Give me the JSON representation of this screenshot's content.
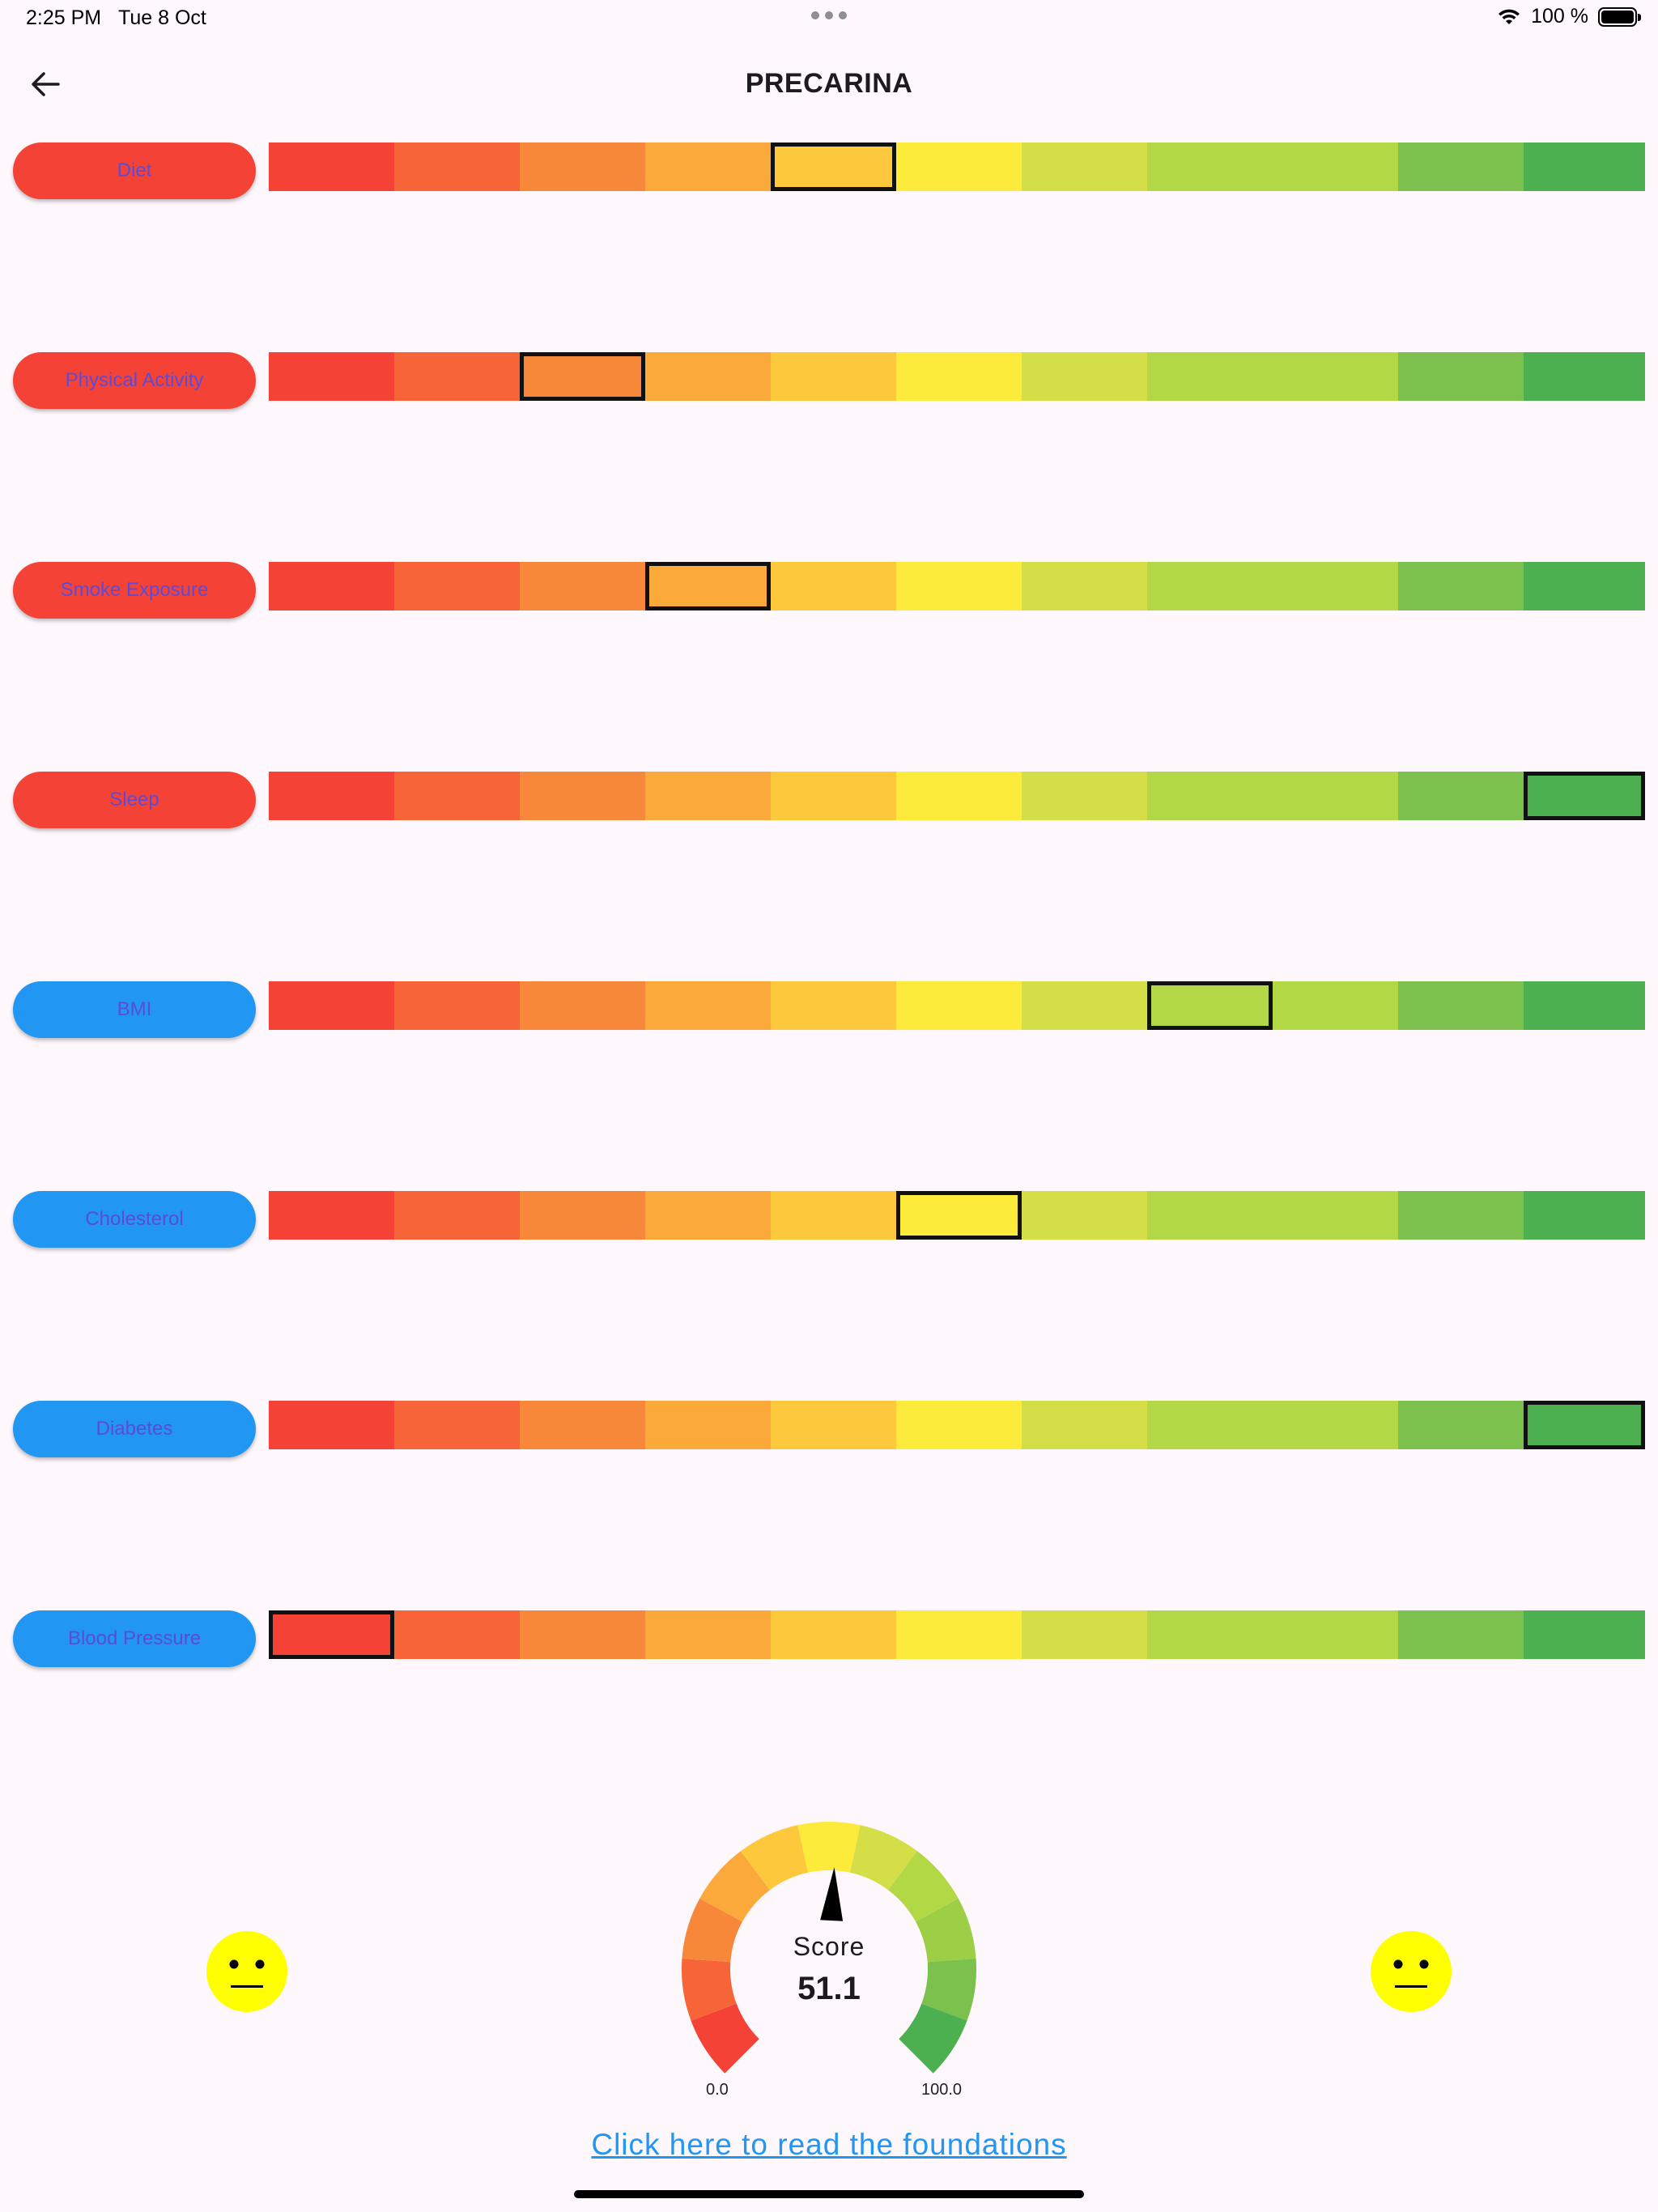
{
  "status_bar": {
    "time": "2:25 PM",
    "date": "Tue 8 Oct",
    "battery": "100 %"
  },
  "header": {
    "title": "PRECARINA",
    "back_icon": "arrow-left-icon"
  },
  "scale_colors": [
    "#f44336",
    "#f76438",
    "#f7883a",
    "#fba93a",
    "#fec83c",
    "#fdeb3b",
    "#d4de46",
    "#b2d845",
    "#b2d845",
    "#7cc04d",
    "#4caf50"
  ],
  "categories": [
    {
      "label": "Diet",
      "color": "red",
      "selected_index": 4
    },
    {
      "label": "Physical Activity",
      "color": "red",
      "selected_index": 2
    },
    {
      "label": "Smoke Exposure",
      "color": "red",
      "selected_index": 3
    },
    {
      "label": "Sleep",
      "color": "red",
      "selected_index": 10
    },
    {
      "label": "BMI",
      "color": "blue",
      "selected_index": 7
    },
    {
      "label": "Cholesterol",
      "color": "blue",
      "selected_index": 5
    },
    {
      "label": "Diabetes",
      "color": "blue",
      "selected_index": 10
    },
    {
      "label": "Blood Pressure",
      "color": "blue",
      "selected_index": 0
    }
  ],
  "gauge": {
    "label": "Score",
    "value": 51.1,
    "value_text": "51.1",
    "min_label": "0.0",
    "max_label": "100.0",
    "min": 0,
    "max": 100
  },
  "faces": [
    "neutral-face-icon",
    "neutral-face-icon"
  ],
  "link_text": "Click here to read the foundations"
}
